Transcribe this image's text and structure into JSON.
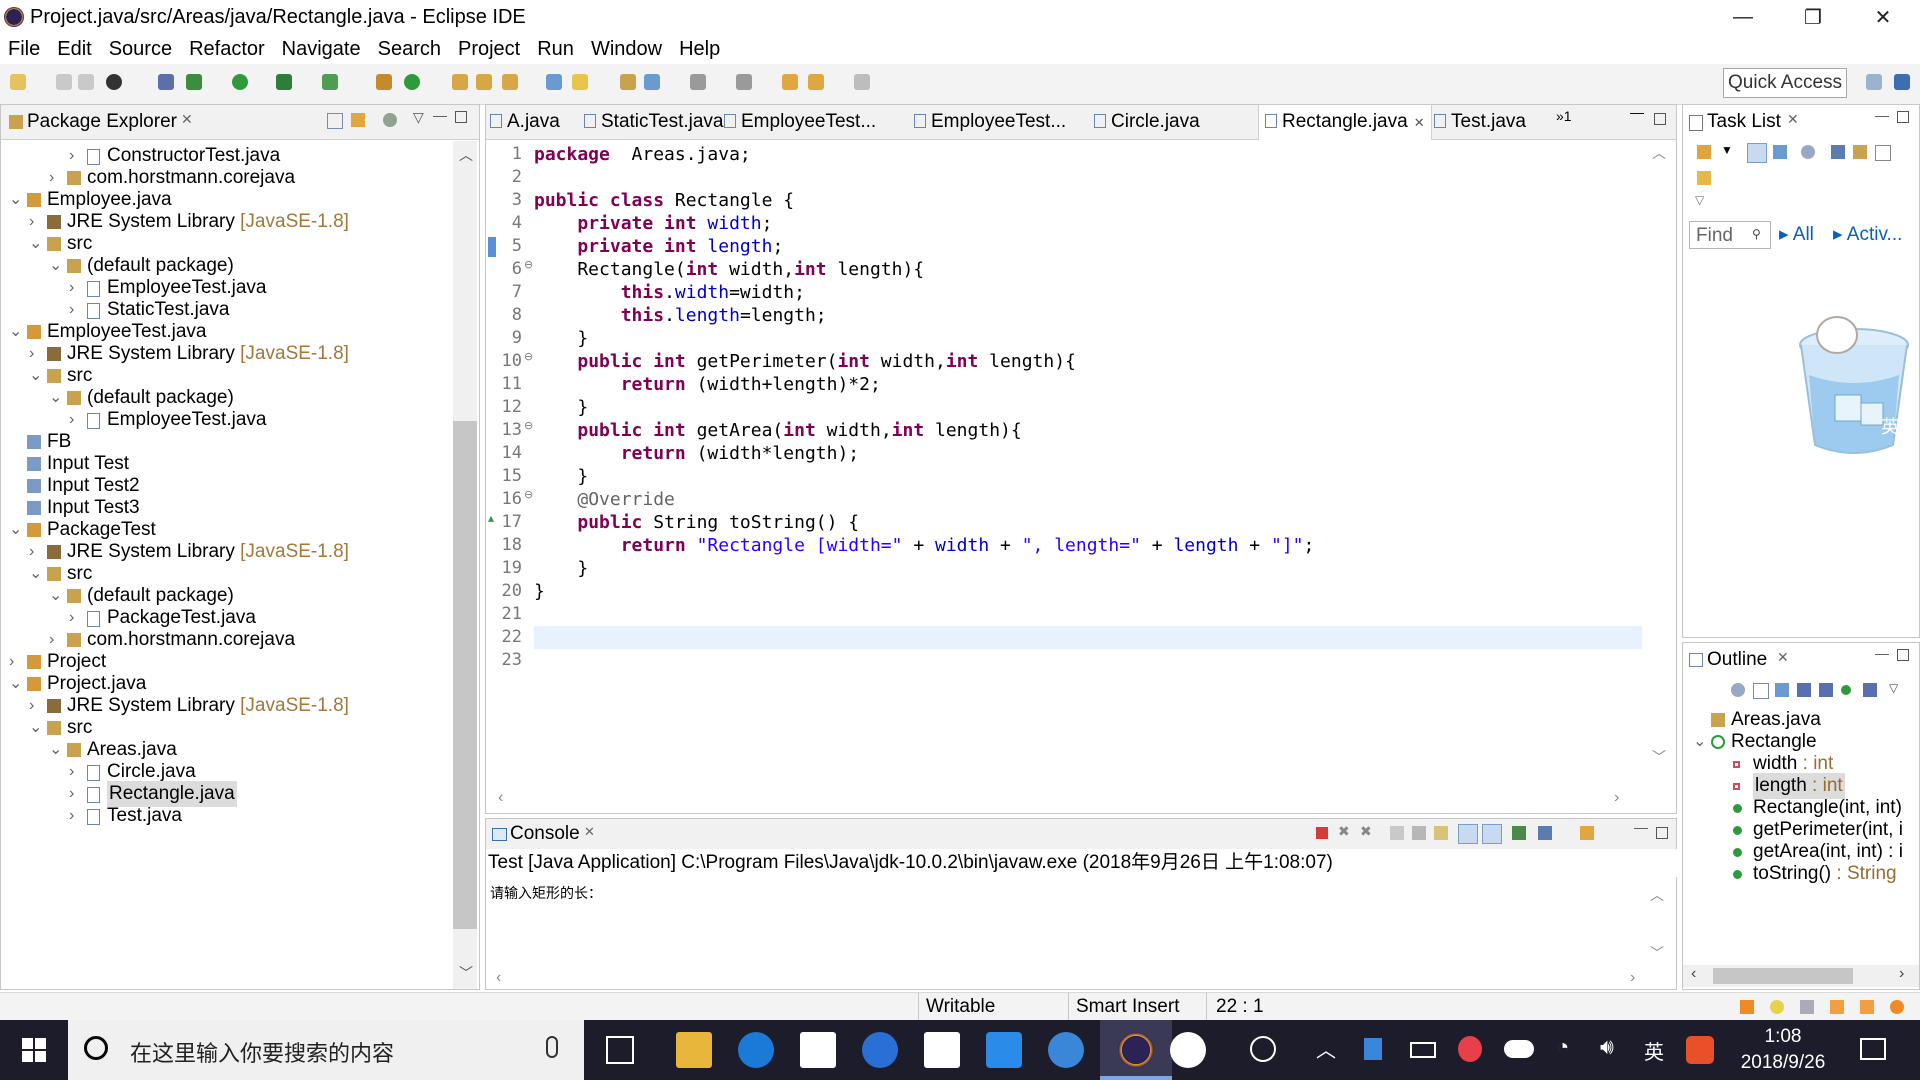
{
  "window": {
    "title": "Project.java/src/Areas/java/Rectangle.java - Eclipse IDE",
    "minimize": "—",
    "restore": "❐",
    "close": "✕"
  },
  "menu": [
    "File",
    "Edit",
    "Source",
    "Refactor",
    "Navigate",
    "Search",
    "Project",
    "Run",
    "Window",
    "Help"
  ],
  "toolbar": {
    "quick_access": "Quick Access"
  },
  "package_explorer": {
    "title": "Package Explorer",
    "rows": [
      {
        "label": "ConstructorTest.java",
        "indent": 4,
        "twisty": "›",
        "icon": "java-file-icon"
      },
      {
        "label": "com.horstmann.corejava",
        "indent": 3,
        "twisty": "›",
        "icon": "package-icon"
      },
      {
        "label": "Employee.java",
        "indent": 1,
        "twisty": "⌄",
        "icon": "project-icon"
      },
      {
        "label": "JRE System Library",
        "suffix": " [JavaSE-1.8]",
        "indent": 2,
        "twisty": "›",
        "icon": "library-icon"
      },
      {
        "label": "src",
        "indent": 2,
        "twisty": "⌄",
        "icon": "src-folder-icon"
      },
      {
        "label": "(default package)",
        "indent": 3,
        "twisty": "⌄",
        "icon": "package-icon"
      },
      {
        "label": "EmployeeTest.java",
        "indent": 4,
        "twisty": "›",
        "icon": "java-file-icon"
      },
      {
        "label": "StaticTest.java",
        "indent": 4,
        "twisty": "›",
        "icon": "java-file-icon"
      },
      {
        "label": "EmployeeTest.java",
        "indent": 1,
        "twisty": "⌄",
        "icon": "project-icon"
      },
      {
        "label": "JRE System Library",
        "suffix": " [JavaSE-1.8]",
        "indent": 2,
        "twisty": "›",
        "icon": "library-icon"
      },
      {
        "label": "src",
        "indent": 2,
        "twisty": "⌄",
        "icon": "src-folder-icon"
      },
      {
        "label": "(default package)",
        "indent": 3,
        "twisty": "⌄",
        "icon": "package-icon"
      },
      {
        "label": "EmployeeTest.java",
        "indent": 4,
        "twisty": "›",
        "icon": "java-file-icon"
      },
      {
        "label": "FB",
        "indent": 1,
        "twisty": "",
        "icon": "closed-project-icon"
      },
      {
        "label": "Input Test",
        "indent": 1,
        "twisty": "",
        "icon": "closed-project-icon"
      },
      {
        "label": "Input Test2",
        "indent": 1,
        "twisty": "",
        "icon": "closed-project-icon"
      },
      {
        "label": "Input Test3",
        "indent": 1,
        "twisty": "",
        "icon": "closed-project-icon"
      },
      {
        "label": "PackageTest",
        "indent": 1,
        "twisty": "⌄",
        "icon": "project-icon"
      },
      {
        "label": "JRE System Library",
        "suffix": " [JavaSE-1.8]",
        "indent": 2,
        "twisty": "›",
        "icon": "library-icon"
      },
      {
        "label": "src",
        "indent": 2,
        "twisty": "⌄",
        "icon": "src-folder-icon"
      },
      {
        "label": "(default package)",
        "indent": 3,
        "twisty": "⌄",
        "icon": "package-icon"
      },
      {
        "label": "PackageTest.java",
        "indent": 4,
        "twisty": "›",
        "icon": "java-file-icon"
      },
      {
        "label": "com.horstmann.corejava",
        "indent": 3,
        "twisty": "›",
        "icon": "package-icon"
      },
      {
        "label": "Project",
        "indent": 1,
        "twisty": "›",
        "icon": "project-icon"
      },
      {
        "label": "Project.java",
        "indent": 1,
        "twisty": "⌄",
        "icon": "project-icon"
      },
      {
        "label": "JRE System Library",
        "suffix": " [JavaSE-1.8]",
        "indent": 2,
        "twisty": "›",
        "icon": "library-icon"
      },
      {
        "label": "src",
        "indent": 2,
        "twisty": "⌄",
        "icon": "src-folder-icon"
      },
      {
        "label": "Areas.java",
        "indent": 3,
        "twisty": "⌄",
        "icon": "package-icon"
      },
      {
        "label": "Circle.java",
        "indent": 4,
        "twisty": "›",
        "icon": "java-file-icon"
      },
      {
        "label": "Rectangle.java",
        "indent": 4,
        "twisty": "›",
        "icon": "java-file-icon",
        "selected": true
      },
      {
        "label": "Test.java",
        "indent": 4,
        "twisty": "›",
        "icon": "java-file-icon"
      }
    ]
  },
  "editor": {
    "tabs": [
      {
        "label": "A.java"
      },
      {
        "label": "StaticTest.java"
      },
      {
        "label": "EmployeeTest..."
      },
      {
        "label": "EmployeeTest..."
      },
      {
        "label": "Circle.java"
      },
      {
        "label": "Rectangle.java",
        "active": true,
        "close": "✕"
      },
      {
        "label": "Test.java"
      }
    ],
    "overflow": "»1",
    "lines": [
      [
        [
          "kw",
          "package"
        ],
        [
          "",
          "  Areas.java;"
        ]
      ],
      [],
      [
        [
          "kw",
          "public class"
        ],
        [
          "",
          " Rectangle {"
        ]
      ],
      [
        [
          "",
          "    "
        ],
        [
          "kw",
          "private int"
        ],
        [
          "fld",
          " width"
        ],
        [
          "",
          ";"
        ]
      ],
      [
        [
          "",
          "    "
        ],
        [
          "kw",
          "private int"
        ],
        [
          "fld",
          " length"
        ],
        [
          "",
          ";"
        ]
      ],
      [
        [
          "",
          "    Rectangle("
        ],
        [
          "kw",
          "int"
        ],
        [
          "",
          " width,"
        ],
        [
          "kw",
          "int"
        ],
        [
          "",
          " length){"
        ]
      ],
      [
        [
          "",
          "        "
        ],
        [
          "kw",
          "this"
        ],
        [
          "",
          "."
        ],
        [
          "fld",
          "width"
        ],
        [
          "",
          "=width;"
        ]
      ],
      [
        [
          "",
          "        "
        ],
        [
          "kw",
          "this"
        ],
        [
          "",
          "."
        ],
        [
          "fld",
          "length"
        ],
        [
          "",
          "=length;"
        ]
      ],
      [
        [
          "",
          "    }"
        ]
      ],
      [
        [
          "",
          "    "
        ],
        [
          "kw",
          "public int"
        ],
        [
          "",
          " getPerimeter("
        ],
        [
          "kw",
          "int"
        ],
        [
          "",
          " width,"
        ],
        [
          "kw",
          "int"
        ],
        [
          "",
          " length){"
        ]
      ],
      [
        [
          "",
          "        "
        ],
        [
          "kw",
          "return"
        ],
        [
          "",
          " (width+length)*2;"
        ]
      ],
      [
        [
          "",
          "    }"
        ]
      ],
      [
        [
          "",
          "    "
        ],
        [
          "kw",
          "public int"
        ],
        [
          "",
          " getArea("
        ],
        [
          "kw",
          "int"
        ],
        [
          "",
          " width,"
        ],
        [
          "kw",
          "int"
        ],
        [
          "",
          " length){"
        ]
      ],
      [
        [
          "",
          "        "
        ],
        [
          "kw",
          "return"
        ],
        [
          "",
          " (width*length);"
        ]
      ],
      [
        [
          "",
          "    }"
        ]
      ],
      [
        [
          "",
          "    "
        ],
        [
          "ann",
          "@Override"
        ]
      ],
      [
        [
          "",
          "    "
        ],
        [
          "kw",
          "public"
        ],
        [
          "",
          " String toString() {"
        ]
      ],
      [
        [
          "",
          "        "
        ],
        [
          "kw",
          "return"
        ],
        [
          "str",
          " \"Rectangle [width=\""
        ],
        [
          "",
          " + "
        ],
        [
          "fld",
          "width"
        ],
        [
          "",
          " + "
        ],
        [
          "str",
          "\", length=\""
        ],
        [
          "",
          " + "
        ],
        [
          "fld",
          "length"
        ],
        [
          "",
          " + "
        ],
        [
          "str",
          "\"]\""
        ],
        [
          "",
          ";"
        ]
      ],
      [
        [
          "",
          "    }"
        ]
      ],
      [
        [
          "",
          "}"
        ]
      ],
      [],
      [],
      []
    ]
  },
  "console": {
    "title": "Console",
    "header": "Test [Java Application] C:\\Program Files\\Java\\jdk-10.0.2\\bin\\javaw.exe (2018年9月26日 上午1:08:07)",
    "output": "请输入矩形的长："
  },
  "task_list": {
    "title": "Task List",
    "find_placeholder": "Find",
    "all": "All",
    "activ": "Activ..."
  },
  "outline": {
    "title": "Outline",
    "items": [
      {
        "label": "Areas.java",
        "type": "",
        "indent": 0,
        "icon": "package-icon"
      },
      {
        "label": "Rectangle",
        "type": "",
        "indent": 0,
        "icon": "class-icon",
        "twisty": "⌄"
      },
      {
        "label": "width",
        "type": " : int",
        "indent": 1,
        "icon": "private-field-icon"
      },
      {
        "label": "length",
        "type": " : int",
        "indent": 1,
        "icon": "private-field-icon",
        "selected": true
      },
      {
        "label": "Rectangle(int, int)",
        "type": "",
        "indent": 1,
        "icon": "constructor-icon"
      },
      {
        "label": "getPerimeter(int, i",
        "type": "",
        "indent": 1,
        "icon": "method-icon"
      },
      {
        "label": "getArea(int, int) : i",
        "type": "",
        "indent": 1,
        "icon": "method-icon"
      },
      {
        "label": "toString()",
        "type": " : String",
        "indent": 1,
        "icon": "override-method-icon"
      }
    ]
  },
  "status": {
    "writable": "Writable",
    "insert": "Smart Insert",
    "position": "22 : 1"
  },
  "taskbar": {
    "search_placeholder": "在这里输入你要搜索的内容",
    "time": "1:08",
    "date": "2018/9/26",
    "ime": "英"
  }
}
